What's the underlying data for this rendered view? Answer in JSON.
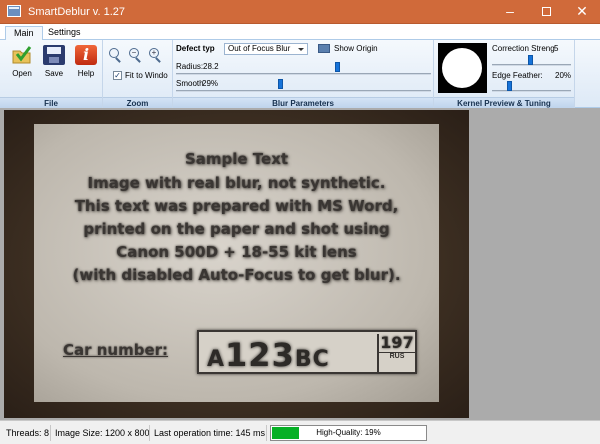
{
  "window": {
    "title": "SmartDeblur v. 1.27",
    "minimize_glyph": "–",
    "close_glyph": "✕"
  },
  "tabs": [
    {
      "label": "Main",
      "active": true
    },
    {
      "label": "Settings",
      "active": false
    }
  ],
  "ribbon": {
    "file": {
      "label": "File",
      "open_label": "Open",
      "save_label": "Save",
      "help_label": "Help",
      "help_glyph": "i",
      "icons": [
        "open-icon",
        "save-icon",
        "help-icon"
      ]
    },
    "zoom": {
      "label": "Zoom",
      "zoom_in_glyph": "+",
      "zoom_out_glyph": "−",
      "fit_label": "Fit to Windo",
      "fit_checked": true,
      "check_glyph": "✓"
    },
    "blur": {
      "label": "Blur Parameters",
      "defect_type_label": "Defect typ",
      "defect_type_value": "Out of Focus Blur",
      "show_origin_label": "Show Origin",
      "radius_label": "Radius:",
      "radius_value": "28.2",
      "smooth_label": "Smooth",
      "smooth_value": "29%"
    },
    "kernel": {
      "label": "Kernel Preview & Tuning",
      "correction_label": "Correction Streng",
      "correction_value": "5",
      "edge_feather_label": "Edge Feather:",
      "edge_feather_value": "20%"
    }
  },
  "image": {
    "lines": [
      "Sample Text",
      "Image with real blur, not synthetic.",
      "This text was prepared with MS Word,",
      "printed on the paper and shot using",
      "Canon 500D + 18-55 kit lens",
      "(with disabled Auto-Focus to get blur)."
    ],
    "car_number_label": "Car number:",
    "plate_letter_1": "A",
    "plate_digits": "123",
    "plate_letters_2": "BC",
    "plate_region": "197",
    "plate_country": "RUS"
  },
  "status": {
    "threads": "Threads: 8",
    "image_size": "Image Size: 1200 x 800",
    "last_op": "Last operation time: 145 ms",
    "quality_label": "High-Quality: 19%",
    "quality_percent": 19,
    "progress_color": "#06b025"
  },
  "colors": {
    "titlebar": "#d06a3a",
    "accent": "#1673d9"
  }
}
